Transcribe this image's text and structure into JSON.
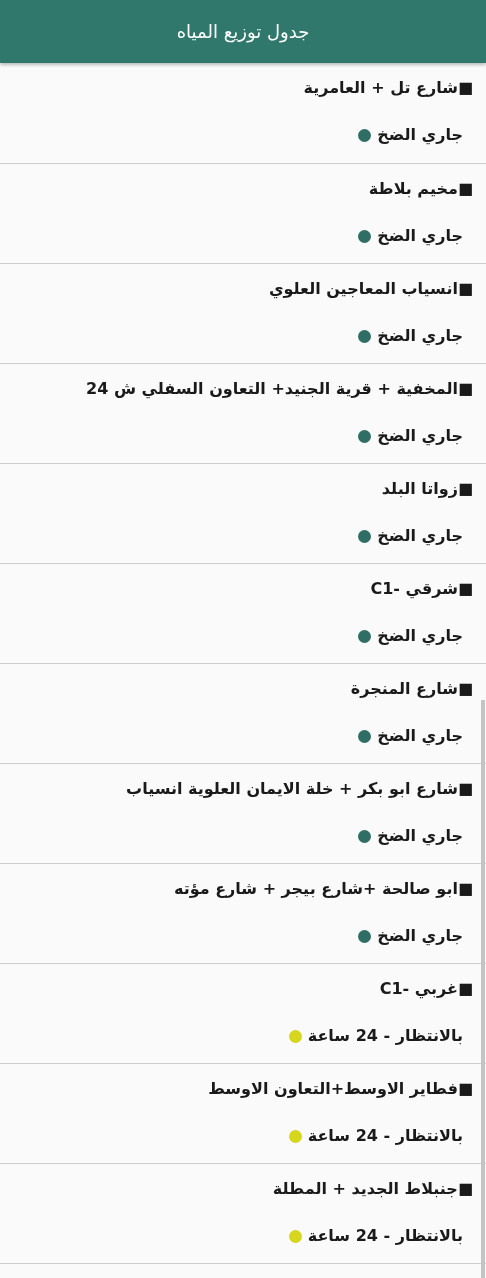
{
  "app_bar": {
    "title": "جدول توزيع المياه"
  },
  "areas": [
    {
      "name": "■شارع تل + العامرية",
      "status": "جاري الضخ",
      "color": "#2e6e64"
    },
    {
      "name": "■مخيم بلاطة",
      "status": "جاري الضخ",
      "color": "#2e6e64"
    },
    {
      "name": "■انسياب المعاجين العلوي",
      "status": "جاري الضخ",
      "color": "#2e6e64"
    },
    {
      "name": "■المخفية + قرية الجنيد+ التعاون السفلي ش 24",
      "status": "جاري الضخ",
      "color": "#2e6e64"
    },
    {
      "name": "■زواتا البلد",
      "status": "جاري الضخ",
      "color": "#2e6e64"
    },
    {
      "name": "■شرقي -C1",
      "status": "جاري الضخ",
      "color": "#2e6e64"
    },
    {
      "name": "■شارع المنجرة",
      "status": "جاري الضخ",
      "color": "#2e6e64"
    },
    {
      "name": "■شارع ابو بكر + خلة الايمان العلوية انسياب",
      "status": "جاري الضخ",
      "color": "#2e6e64"
    },
    {
      "name": "■ابو صالحة +شارع بيجر + شارع مؤته",
      "status": "جاري الضخ",
      "color": "#2e6e64"
    },
    {
      "name": "■غربي -C1",
      "status": "بالانتظار - 24 ساعة",
      "color": "#d6d61c"
    },
    {
      "name": "■فطاير الاوسط+التعاون الاوسط",
      "status": "بالانتظار - 24 ساعة",
      "color": "#d6d61c"
    },
    {
      "name": "■جنبلاط الجديد + المطلة",
      "status": "بالانتظار - 24 ساعة",
      "color": "#d6d61c"
    }
  ]
}
